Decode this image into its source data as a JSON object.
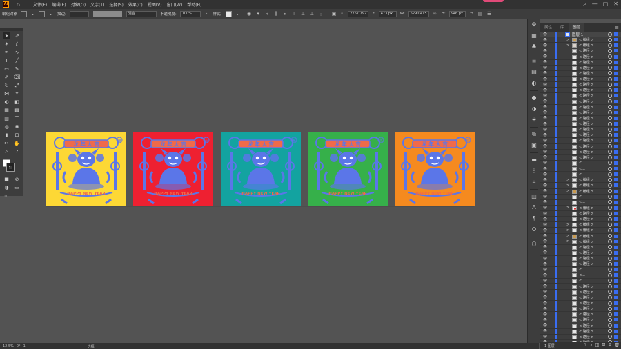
{
  "menubar": {
    "logo": "Ai",
    "items": [
      "文件(F)",
      "编辑(E)",
      "对象(O)",
      "文字(T)",
      "选择(S)",
      "效果(C)",
      "视图(V)",
      "窗口(W)",
      "帮助(H)"
    ]
  },
  "controlbar": {
    "selection_label": "编组对象",
    "stroke_label": "描边:",
    "blend_mode": "混合",
    "opacity_label": "不透明度:",
    "opacity_value": "100%",
    "style_label": "样式:",
    "x_label": "X:",
    "x_value": "2767.792",
    "y_label": "Y:",
    "y_value": "473 px",
    "w_label": "W:",
    "w_value": "5290.415",
    "h_label": "H:",
    "h_value": "946 px"
  },
  "statusbar": {
    "zoom": "12.5%",
    "rotation": "0°",
    "artboard": "1",
    "tool": "选择"
  },
  "layers_panel": {
    "tabs": [
      "属性",
      "库",
      "图层"
    ],
    "active_tab": "图层",
    "layer_count": "1 图层",
    "rows": [
      {
        "name": "图层 1",
        "expander": "∨",
        "thumb": "top"
      },
      {
        "name": "< 编组 >",
        "expander": ">",
        "thumb": "art"
      },
      {
        "name": "< 编组 >",
        "expander": ">",
        "thumb": "fire"
      },
      {
        "name": "< 路径 >",
        "expander": "",
        "thumb": "plain"
      },
      {
        "name": "< 路径 >",
        "expander": "",
        "thumb": "plain"
      },
      {
        "name": "< 路径 >",
        "expander": "",
        "thumb": "plain"
      },
      {
        "name": "< 路径 >",
        "expander": "",
        "thumb": "plain"
      },
      {
        "name": "< 路径 >",
        "expander": "",
        "thumb": "plain"
      },
      {
        "name": "< 路径 >",
        "expander": "",
        "thumb": "plain"
      },
      {
        "name": "< 路径 >",
        "expander": "",
        "thumb": "plain"
      },
      {
        "name": "< 路径 >",
        "expander": "",
        "thumb": "plain"
      },
      {
        "name": "< 路径 >",
        "expander": "",
        "thumb": "plain"
      },
      {
        "name": "< 路径 >",
        "expander": "",
        "thumb": "plain"
      },
      {
        "name": "< 路径 >",
        "expander": "",
        "thumb": "plain"
      },
      {
        "name": "< 路径 >",
        "expander": "",
        "thumb": "plain"
      },
      {
        "name": "< 路径 >",
        "expander": "",
        "thumb": "plain"
      },
      {
        "name": "< 路径 >",
        "expander": "",
        "thumb": "plain"
      },
      {
        "name": "< 路径 >",
        "expander": "",
        "thumb": "plain"
      },
      {
        "name": "< 路径 >",
        "expander": "",
        "thumb": "plain"
      },
      {
        "name": "< 路径 >",
        "expander": "",
        "thumb": "plain"
      },
      {
        "name": "< 路径 >",
        "expander": "",
        "thumb": "plain"
      },
      {
        "name": "< 路径 >",
        "expander": "",
        "thumb": "plain"
      },
      {
        "name": "< 路径 >",
        "expander": "",
        "thumb": "plain"
      },
      {
        "name": "<...",
        "expander": "",
        "thumb": "plain"
      },
      {
        "name": "<...",
        "expander": "",
        "thumb": "plain"
      },
      {
        "name": "<...",
        "expander": "",
        "thumb": "plain"
      },
      {
        "name": "< 编组 >",
        "expander": ">",
        "thumb": "plain"
      },
      {
        "name": "< 编组 >",
        "expander": ">",
        "thumb": "plain"
      },
      {
        "name": "< 编组 >",
        "expander": ">",
        "thumb": "art"
      },
      {
        "name": "<...",
        "expander": "",
        "thumb": "plain"
      },
      {
        "name": "<...",
        "expander": "",
        "thumb": "plain"
      },
      {
        "name": "< 编组 >",
        "expander": ">",
        "thumb": "red"
      },
      {
        "name": "< 路径 >",
        "expander": "",
        "thumb": "plain"
      },
      {
        "name": "< 路径 >",
        "expander": "",
        "thumb": "plain"
      },
      {
        "name": "< 编组 >",
        "expander": ">",
        "thumb": "plain"
      },
      {
        "name": "< 编组 >",
        "expander": ">",
        "thumb": "plain"
      },
      {
        "name": "< 编组 >",
        "expander": ">",
        "thumb": "art"
      },
      {
        "name": "< 编组 >",
        "expander": ">",
        "thumb": "plain"
      },
      {
        "name": "< 路径 >",
        "expander": "",
        "thumb": "plain"
      },
      {
        "name": "< 路径 >",
        "expander": "",
        "thumb": "plain"
      },
      {
        "name": "< 路径 >",
        "expander": "",
        "thumb": "plain"
      },
      {
        "name": "< 路径 >",
        "expander": "",
        "thumb": "plain"
      },
      {
        "name": "<...",
        "expander": "",
        "thumb": "plain"
      },
      {
        "name": "<...",
        "expander": "",
        "thumb": "plain"
      },
      {
        "name": "<...",
        "expander": "",
        "thumb": "plain"
      },
      {
        "name": "< 路径 >",
        "expander": "",
        "thumb": "plain"
      },
      {
        "name": "< 路径 >",
        "expander": "",
        "thumb": "plain"
      },
      {
        "name": "< 路径 >",
        "expander": "",
        "thumb": "plain"
      },
      {
        "name": "< 路径 >",
        "expander": "",
        "thumb": "plain"
      },
      {
        "name": "< 路径 >",
        "expander": "",
        "thumb": "plain"
      },
      {
        "name": "< 路径 >",
        "expander": "",
        "thumb": "plain"
      },
      {
        "name": "< 路径 >",
        "expander": "",
        "thumb": "plain"
      },
      {
        "name": "< 路径 >",
        "expander": "",
        "thumb": "plain"
      },
      {
        "name": "< 路径 >",
        "expander": "",
        "thumb": "plain"
      },
      {
        "name": "< 路径 >",
        "expander": "",
        "thumb": "plain"
      },
      {
        "name": "< 路径 >",
        "expander": "",
        "thumb": "plain"
      }
    ]
  },
  "artboards": [
    {
      "bg": "#fdd835",
      "banner": "#f06a4a",
      "badge": "福"
    },
    {
      "bg": "#ee2031",
      "banner": "#f06a4a",
      "badge": "吉"
    },
    {
      "bg": "#13a3a0",
      "banner": "#f06a4a",
      "badge": "春"
    },
    {
      "bg": "#36b04a",
      "banner": "#f06a4a",
      "badge": "喜"
    },
    {
      "bg": "#f58a1f",
      "banner": "#f06a4a",
      "badge": "财"
    }
  ],
  "art": {
    "banner_text": "龙 年 大 吉",
    "greeting": "HAPPY NEW YEAR",
    "figure_color": "#5b76e8"
  },
  "colors": {
    "accent_blue": "#3a6df0",
    "app_bg": "#535353"
  }
}
